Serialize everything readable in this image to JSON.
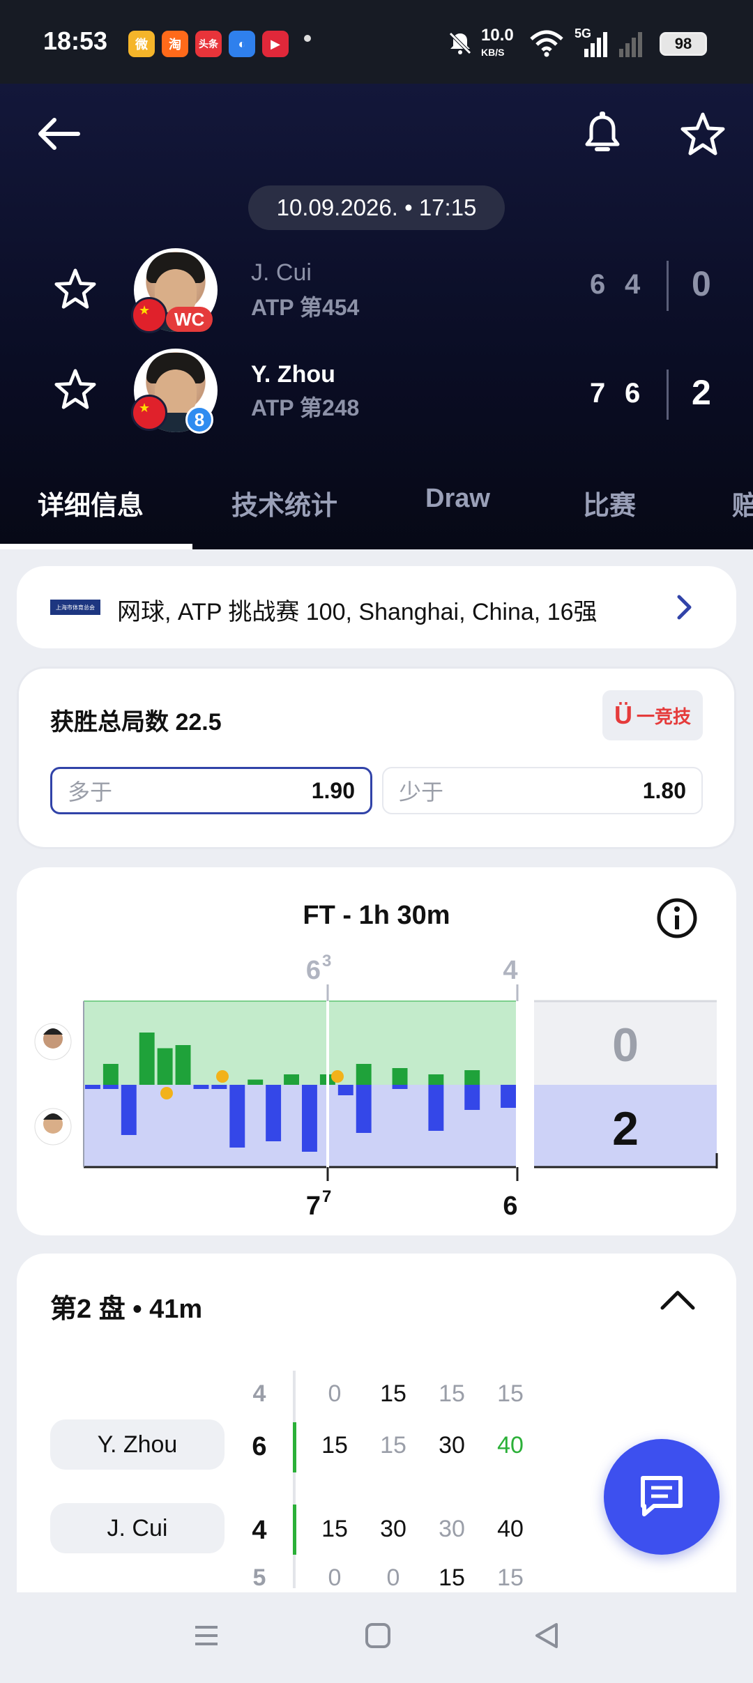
{
  "status_bar": {
    "time": "18:53",
    "apps": [
      "微",
      "淘",
      "头条",
      "◐",
      "▶"
    ],
    "net_speed": "10.0",
    "net_unit": "KB/S",
    "signal": "5G",
    "battery": "98"
  },
  "header": {
    "date": "10.09.2026. • 17:15",
    "players": [
      {
        "name": "J. Cui",
        "rank": "ATP 第454",
        "badge": "WC",
        "sets": [
          "6",
          "4"
        ],
        "score": "0"
      },
      {
        "name": "Y. Zhou",
        "rank": "ATP 第248",
        "badge": "8",
        "sets": [
          "7",
          "6"
        ],
        "score": "2"
      }
    ]
  },
  "tabs": [
    "详细信息",
    "技术统计",
    "Draw",
    "比赛",
    "赔"
  ],
  "tournament": {
    "logo_text": "上海市体育总会",
    "label": "网球, ATP 挑战赛 100, Shanghai, China, 16强"
  },
  "odds": {
    "title": "获胜总局数 22.5",
    "brand": "一竞技",
    "over_label": "多于",
    "over_value": "1.90",
    "under_label": "少于",
    "under_value": "1.80"
  },
  "momentum": {
    "title": "FT - 1h 30m",
    "top_set1": "6",
    "top_set1_tb": "3",
    "top_set2": "4",
    "bottom_set1": "7",
    "bottom_set1_tb": "7",
    "bottom_set2": "6",
    "score_top": "0",
    "score_bottom": "2",
    "top_bars": [
      0,
      2,
      0,
      5,
      3.5,
      3.8,
      0,
      0,
      0,
      0.5,
      0,
      1,
      0,
      1,
      0,
      2,
      0,
      1.6,
      0,
      1,
      0,
      1.4,
      0,
      0
    ],
    "bottom_bars": [
      0.4,
      0.4,
      4.8,
      0,
      0,
      0,
      0.4,
      0.4,
      6,
      0,
      5.4,
      0,
      6.4,
      0,
      1,
      4.6,
      0,
      0.4,
      0,
      4.4,
      0,
      2.4,
      0,
      2.2
    ],
    "colors": {
      "top": "#1fa23a",
      "bottom": "#3447e8",
      "top_bg": "#c3ebcb",
      "bottom_bg": "#cdd2f7"
    }
  },
  "set_section": {
    "title": "第2 盘 • 41m",
    "row_top_games": "4",
    "row_top_points": [
      "0",
      "15",
      "15",
      "15"
    ],
    "zhou_label": "Y. Zhou",
    "zhou_games": "6",
    "zhou_points": [
      "15",
      "15",
      "30",
      "40"
    ],
    "cui_label": "J. Cui",
    "cui_games": "4",
    "cui_points": [
      "15",
      "30",
      "30",
      "40"
    ],
    "row_bottom_games": "5",
    "row_bottom_points": [
      "0",
      "0",
      "15",
      "15"
    ]
  }
}
